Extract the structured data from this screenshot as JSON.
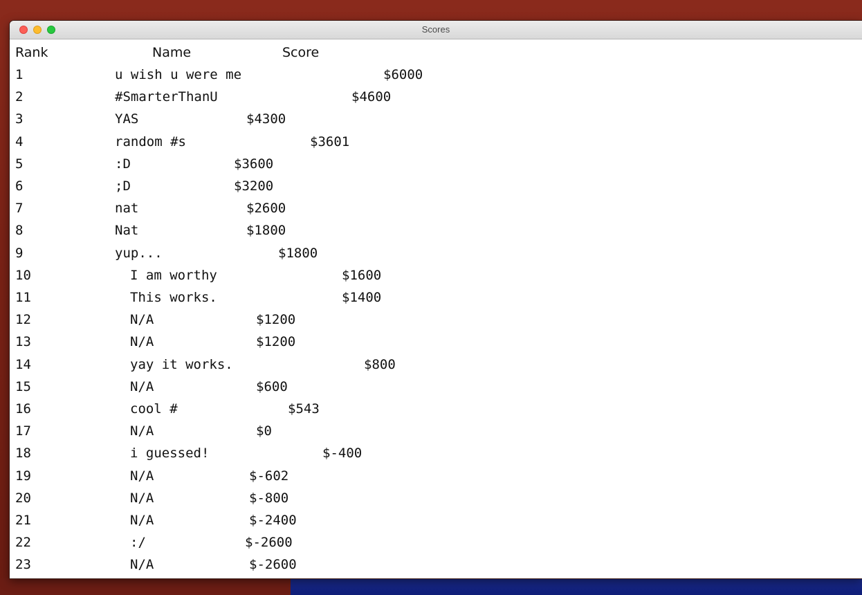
{
  "window": {
    "title": "Scores"
  },
  "header": {
    "rank": "Rank",
    "name": "Name",
    "score": "Score"
  },
  "rows": [
    {
      "rank": "1",
      "name": "u wish u were me",
      "score": "$6000"
    },
    {
      "rank": "2",
      "name": "#SmarterThanU",
      "score": "$4600"
    },
    {
      "rank": "3",
      "name": "YAS",
      "score": "$4300"
    },
    {
      "rank": "4",
      "name": "random #s",
      "score": "$3601"
    },
    {
      "rank": "5",
      "name": ":D",
      "score": "$3600"
    },
    {
      "rank": "6",
      "name": ";D",
      "score": "$3200"
    },
    {
      "rank": "7",
      "name": "nat",
      "score": "$2600"
    },
    {
      "rank": "8",
      "name": "Nat",
      "score": "$1800"
    },
    {
      "rank": "9",
      "name": "yup...",
      "score": "$1800"
    },
    {
      "rank": "10",
      "name": "I am worthy",
      "score": "$1600"
    },
    {
      "rank": "11",
      "name": "This works.",
      "score": "$1400"
    },
    {
      "rank": "12",
      "name": "N/A",
      "score": "$1200"
    },
    {
      "rank": "13",
      "name": "N/A",
      "score": "$1200"
    },
    {
      "rank": "14",
      "name": "yay it works.",
      "score": "$800"
    },
    {
      "rank": "15",
      "name": "N/A",
      "score": "$600"
    },
    {
      "rank": "16",
      "name": "cool #",
      "score": "$543"
    },
    {
      "rank": "17",
      "name": "N/A",
      "score": "$0"
    },
    {
      "rank": "18",
      "name": "i guessed!",
      "score": "$-400"
    },
    {
      "rank": "19",
      "name": "N/A",
      "score": "$-602"
    },
    {
      "rank": "20",
      "name": "N/A",
      "score": "$-800"
    },
    {
      "rank": "21",
      "name": "N/A",
      "score": "$-2400"
    },
    {
      "rank": "22",
      "name": ":/",
      "score": "$-2600"
    },
    {
      "rank": "23",
      "name": "N/A",
      "score": "$-2600"
    }
  ]
}
